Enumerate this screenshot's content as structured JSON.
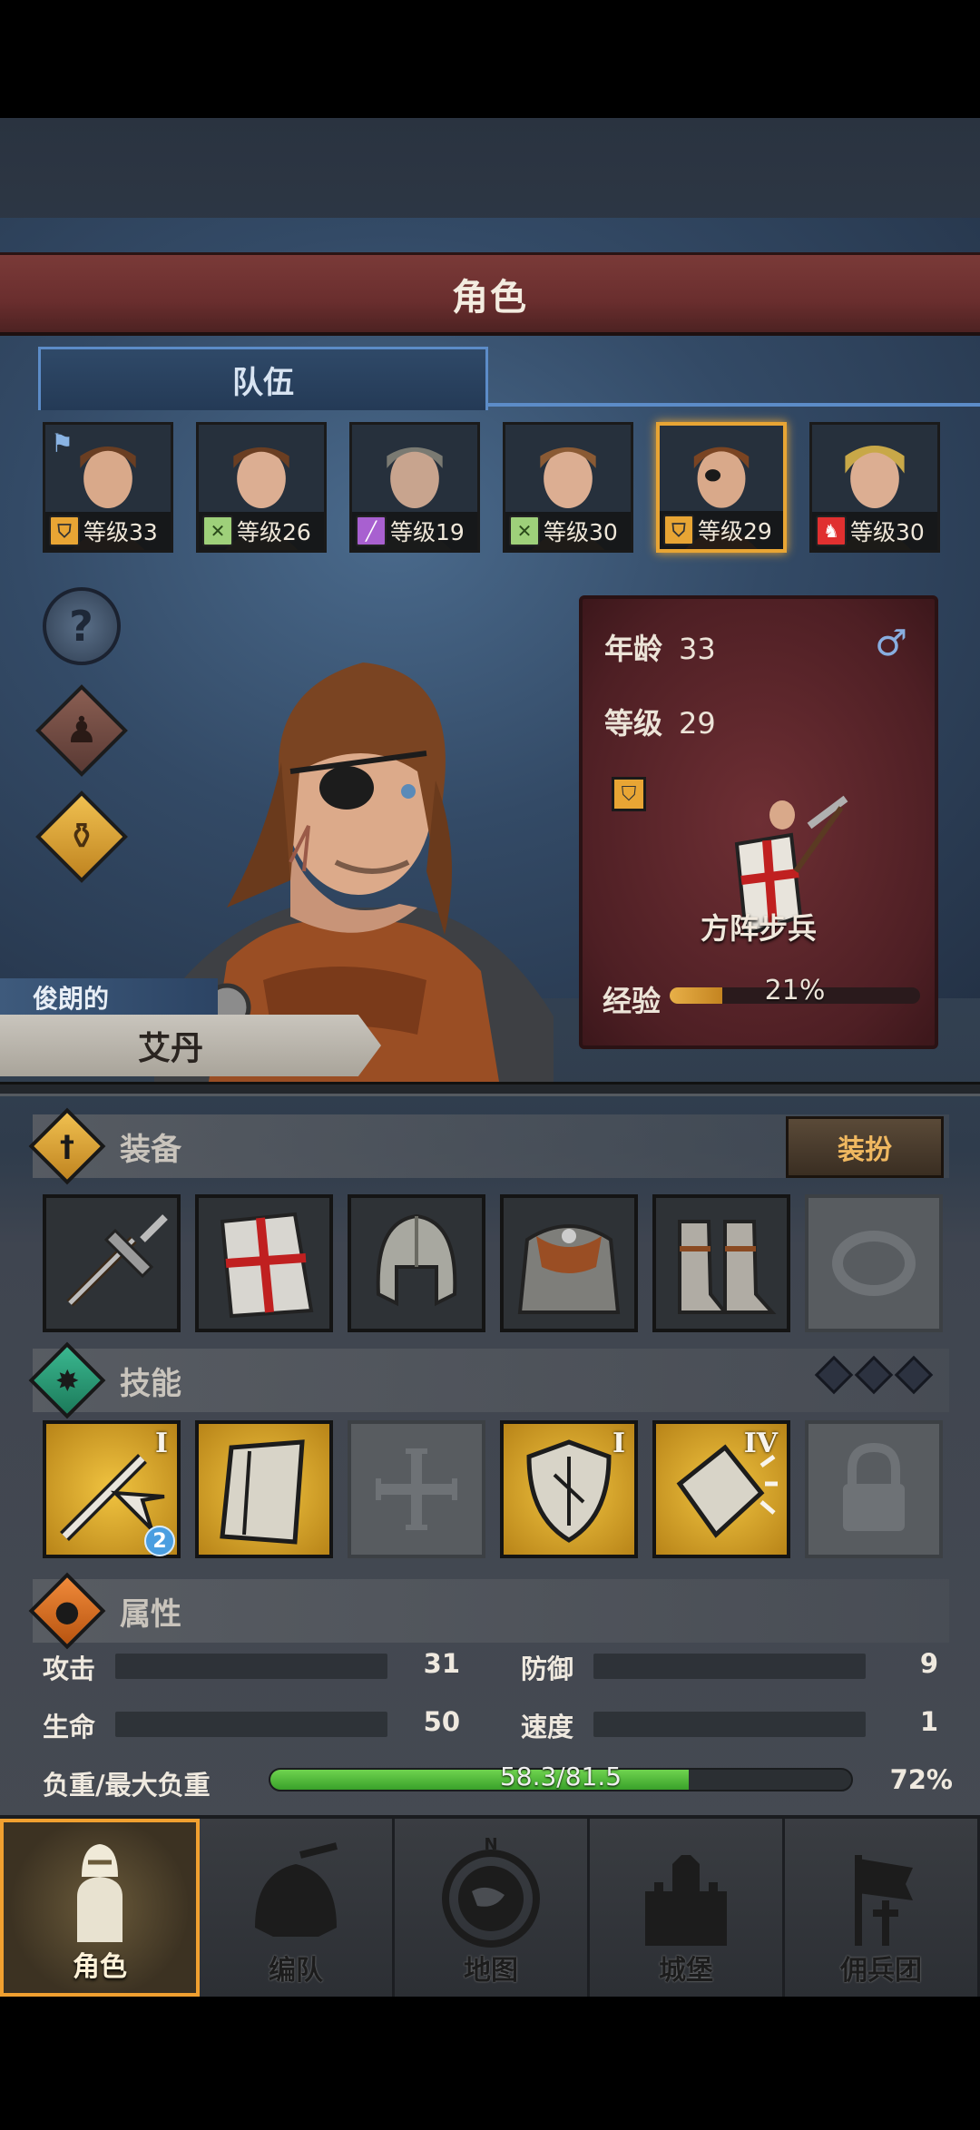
{
  "header": {
    "title": "角色"
  },
  "tabs": {
    "team_label": "队伍"
  },
  "roster": [
    {
      "level": "等级33",
      "class_icon": "shield-icon",
      "class_color": "#e8a534",
      "hair": "#6a3e22",
      "flag": true
    },
    {
      "level": "等级26",
      "class_icon": "crossed-swords-icon",
      "class_color": "#9ed07a",
      "hair": "#6a3e22",
      "flag": false
    },
    {
      "level": "等级19",
      "class_icon": "staff-icon",
      "class_color": "#a860d0",
      "hair": "#7a7a72",
      "flag": false
    },
    {
      "level": "等级30",
      "class_icon": "crossed-swords-icon",
      "class_color": "#9ed07a",
      "hair": "#8a5a34",
      "flag": false
    },
    {
      "level": "等级29",
      "class_icon": "shield-icon",
      "class_color": "#e8a534",
      "hair": "#7a4422",
      "flag": false,
      "active": true
    },
    {
      "level": "等级30",
      "class_icon": "horse-icon",
      "class_color": "#e03030",
      "hair": "#c8a848",
      "flag": false
    }
  ],
  "character": {
    "trait": "俊朗的",
    "name": "艾丹",
    "age_label": "年龄",
    "age": "33",
    "level_label": "等级",
    "level": "29",
    "gender_symbol": "♂",
    "unit_name": "方阵步兵",
    "exp_label": "经验",
    "exp_text": "21%",
    "exp_fraction": 0.21
  },
  "sections": {
    "equipment": "装备",
    "dress_button": "装扮",
    "skills": "技能",
    "attributes": "属性"
  },
  "skills": [
    {
      "roman": "I",
      "badge": "2"
    },
    {
      "roman": ""
    },
    {
      "roman": ""
    },
    {
      "roman": "I"
    },
    {
      "roman": "IV"
    }
  ],
  "attributes": {
    "attack_label": "攻击",
    "attack": "31",
    "defense_label": "防御",
    "defense": "9",
    "hp_label": "生命",
    "hp": "50",
    "speed_label": "速度",
    "speed": "1",
    "load_label": "负重/最大负重",
    "load_text": "58.3/81.5",
    "load_percent": "72%",
    "load_fraction": 0.72
  },
  "nav": [
    {
      "label": "角色"
    },
    {
      "label": "编队"
    },
    {
      "label": "地图",
      "compass": "N"
    },
    {
      "label": "城堡"
    },
    {
      "label": "佣兵团"
    }
  ]
}
